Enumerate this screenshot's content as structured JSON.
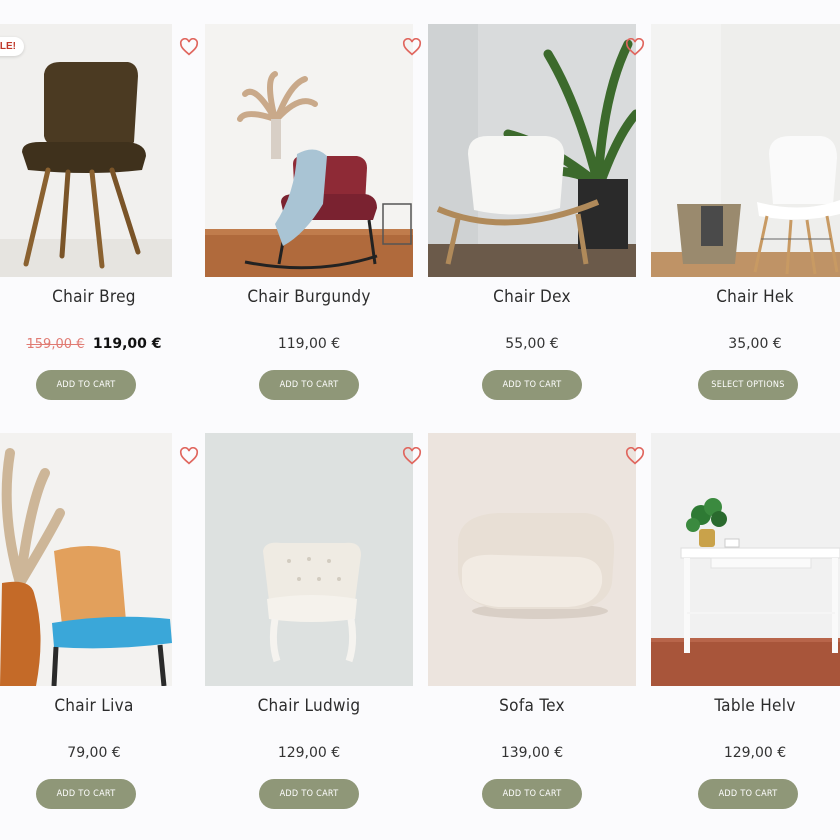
{
  "colors": {
    "button_bg": "#8f9778",
    "sale_price": "#e07b73",
    "heart": "#e0665e"
  },
  "badge": {
    "sale_label": "SALE!"
  },
  "products": [
    {
      "name": "Chair Breg",
      "old_price": "159,00 €",
      "price": "119,00 €",
      "button": "ADD TO CART",
      "image": "brown-chair-photo"
    },
    {
      "name": "Chair Burgundy",
      "price": "119,00 €",
      "button": "ADD TO CART",
      "image": "burgundy-rocking-chair-photo"
    },
    {
      "name": "Chair Dex",
      "price": "55,00 €",
      "button": "ADD TO CART",
      "image": "white-shell-chair-photo"
    },
    {
      "name": "Chair Hek",
      "price": "35,00 €",
      "button": "SELECT OPTIONS",
      "image": "white-eames-chair-photo"
    },
    {
      "name": "Chair Liva",
      "price": "79,00 €",
      "button": "ADD TO CART",
      "image": "wicker-blue-chair-photo"
    },
    {
      "name": "Chair Ludwig",
      "price": "129,00 €",
      "button": "ADD TO CART",
      "image": "tufted-white-chair-photo"
    },
    {
      "name": "Sofa Tex",
      "price": "139,00 €",
      "button": "ADD TO CART",
      "image": "cream-lounge-chair-photo"
    },
    {
      "name": "Table Helv",
      "price": "129,00 €",
      "button": "ADD TO CART",
      "image": "white-desk-photo"
    }
  ]
}
